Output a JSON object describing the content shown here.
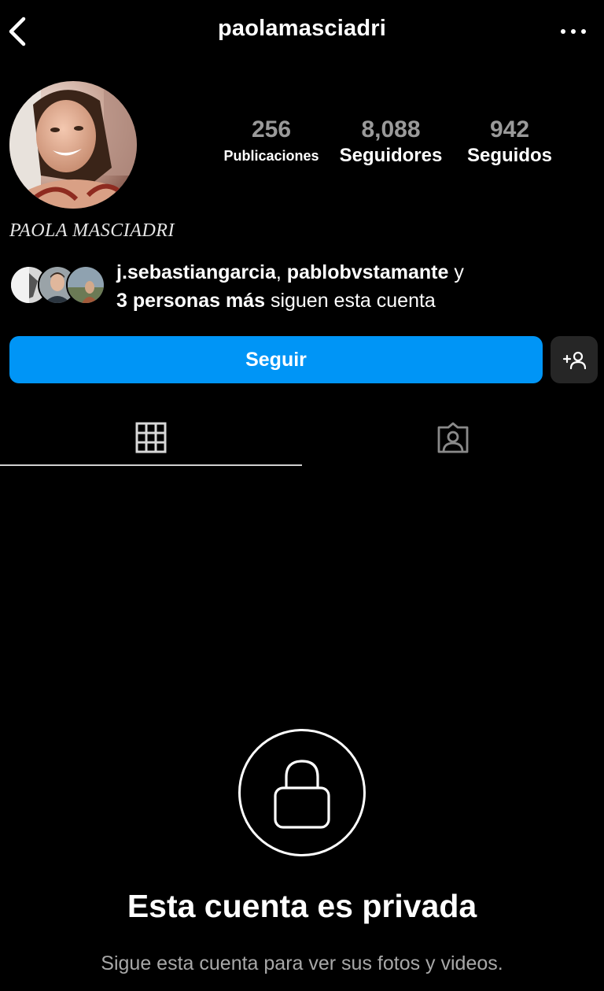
{
  "header": {
    "username": "paolamasciadri",
    "back_icon": "chevron-left-icon",
    "more_label": "···"
  },
  "profile": {
    "full_name": "PAOLA MASCIADRI",
    "stats": {
      "posts_count": "256",
      "posts_label": "Publicaciones",
      "followers_count": "8,088",
      "followers_label": "Seguidores",
      "following_count": "942",
      "following_label": "Seguidos"
    }
  },
  "followed_by": {
    "user1": "j.sebastiangarcia",
    "sep": ", ",
    "user2": "pablobvstamante",
    "and": " y",
    "more": "3 personas más",
    "suffix": " siguen esta cuenta"
  },
  "actions": {
    "follow_label": "Seguir",
    "suggest_icon": "add-person-icon"
  },
  "tabs": [
    {
      "name": "grid",
      "icon": "grid-icon",
      "active": true
    },
    {
      "name": "tagged",
      "icon": "tagged-person-icon",
      "active": false
    }
  ],
  "private": {
    "icon": "lock-icon",
    "title": "Esta cuenta es privada",
    "subtitle": "Sigue esta cuenta para ver sus fotos y videos."
  },
  "colors": {
    "background": "#000000",
    "accent": "#0095f6",
    "secondary_button": "#262626",
    "muted_text": "#a8a8a8"
  }
}
